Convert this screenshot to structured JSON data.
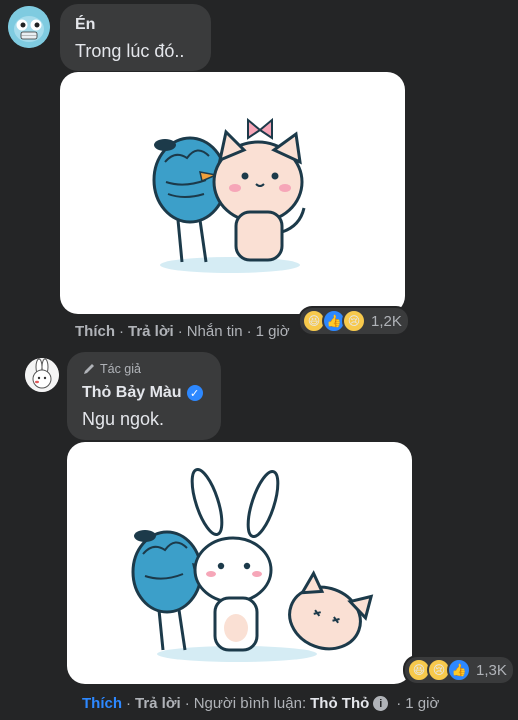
{
  "comment1": {
    "author": "Én",
    "text": "Trong lúc đó..",
    "actions": {
      "like": "Thích",
      "reply": "Trả lời",
      "extra": "Nhắn tin",
      "time": "1 giờ"
    },
    "reactions": {
      "icons": [
        "haha",
        "like",
        "sad"
      ],
      "count": "1,2K"
    }
  },
  "comment2": {
    "author_badge": "Tác giả",
    "author": "Thỏ Bảy Màu",
    "text": "Ngu ngok.",
    "actions": {
      "like": "Thích",
      "reply": "Trả lời",
      "commenter_label": "Người bình luận:",
      "commenter_name": "Thỏ Thỏ",
      "time": "1 giờ"
    },
    "reactions": {
      "icons": [
        "haha",
        "sad",
        "like"
      ],
      "count": "1,3K"
    }
  },
  "colors": {
    "background": "#242526",
    "bubble": "#3a3b3c",
    "text": "#e4e6eb",
    "muted": "#b0b3b8",
    "accent": "#2d88ff"
  }
}
